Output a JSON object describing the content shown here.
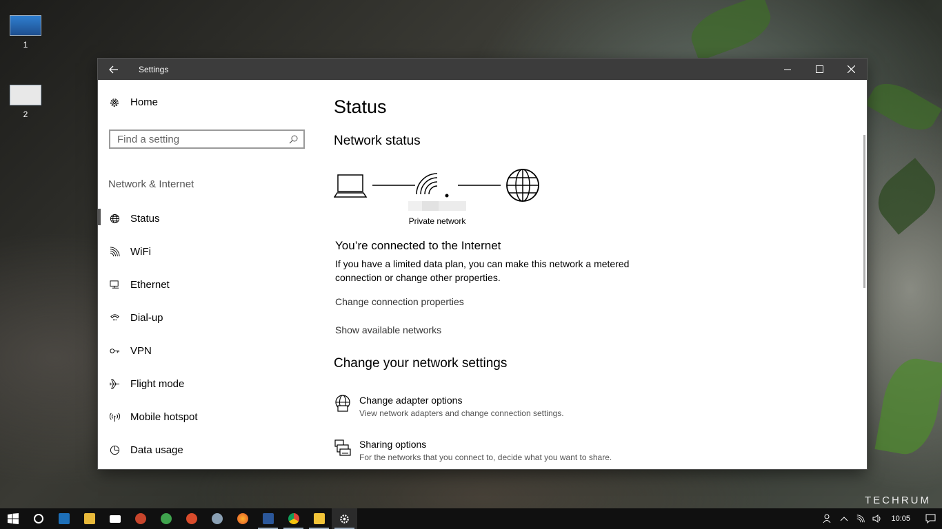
{
  "desktop": {
    "icons": [
      {
        "label": "1"
      },
      {
        "label": "2"
      }
    ]
  },
  "window": {
    "title": "Settings"
  },
  "sidebar": {
    "home_label": "Home",
    "search_placeholder": "Find a setting",
    "section_title": "Network & Internet",
    "items": [
      {
        "label": "Status",
        "icon": "globe-icon",
        "active": true
      },
      {
        "label": "WiFi",
        "icon": "wifi-icon"
      },
      {
        "label": "Ethernet",
        "icon": "ethernet-icon"
      },
      {
        "label": "Dial-up",
        "icon": "dialup-icon"
      },
      {
        "label": "VPN",
        "icon": "vpn-icon"
      },
      {
        "label": "Flight mode",
        "icon": "airplane-icon"
      },
      {
        "label": "Mobile hotspot",
        "icon": "hotspot-icon"
      },
      {
        "label": "Data usage",
        "icon": "data-usage-icon"
      }
    ]
  },
  "main": {
    "title": "Status",
    "network_status_heading": "Network status",
    "network_label": "Private network",
    "connected_heading": "You’re connected to the Internet",
    "connected_desc": "If you have a limited data plan, you can make this network a metered connection or change other properties.",
    "link_change_properties": "Change connection properties",
    "link_show_networks": "Show available networks",
    "change_settings_heading": "Change your network settings",
    "options": [
      {
        "title": "Change adapter options",
        "subtitle": "View network adapters and change connection settings.",
        "icon": "adapter-icon"
      },
      {
        "title": "Sharing options",
        "subtitle": "For the networks that you connect to, decide what you want to share.",
        "icon": "sharing-icon"
      }
    ]
  },
  "taskbar": {
    "clock": "10:05",
    "apps": [
      "start",
      "cortana",
      "gotv",
      "file-explorer",
      "mail",
      "app-1",
      "app-2",
      "app-3",
      "app-4",
      "firefox",
      "word",
      "chrome",
      "media-player",
      "settings"
    ]
  },
  "watermark": "TECHRUM",
  "colors": {
    "titlebar": "#3c3c3c",
    "taskbar": "#101010",
    "window_bg": "#ffffff",
    "arrow": "#e02020"
  }
}
